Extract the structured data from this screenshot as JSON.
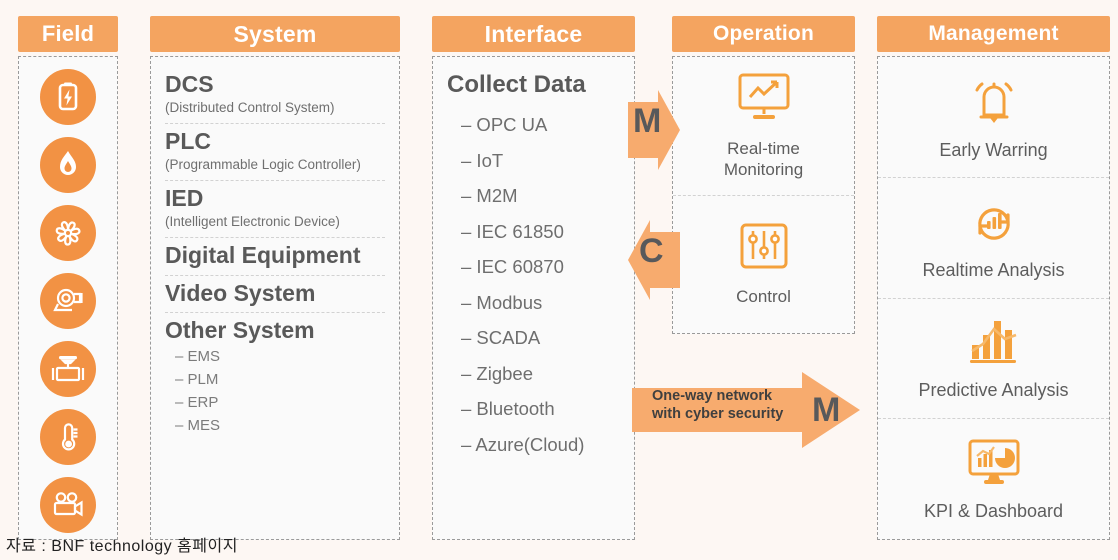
{
  "theme": {
    "header_orange": "#f4a460",
    "icon_orange": "#f29244",
    "arrow_orange": "#f6ab6c",
    "text_gray": "#595959",
    "page_bg": "#fdf7f3"
  },
  "columns": {
    "field": {
      "header": "Field",
      "items": [
        {
          "icon": "battery-power-icon",
          "label": "Power / Battery"
        },
        {
          "icon": "flame-icon",
          "label": "Boiler / Flame"
        },
        {
          "icon": "fan-turbine-icon",
          "label": "Fan / Turbine"
        },
        {
          "icon": "pump-motor-icon",
          "label": "Pump / Motor"
        },
        {
          "icon": "valve-icon",
          "label": "Valve"
        },
        {
          "icon": "thermometer-icon",
          "label": "Temperature Sensor"
        },
        {
          "icon": "video-camera-icon",
          "label": "Video Camera"
        }
      ]
    },
    "system": {
      "header": "System",
      "groups": [
        {
          "title": "DCS",
          "sub": "(Distributed Control System)",
          "items": []
        },
        {
          "title": "PLC",
          "sub": "(Programmable Logic Controller)",
          "items": []
        },
        {
          "title": "IED",
          "sub": "(Intelligent Electronic Device)",
          "items": []
        },
        {
          "title": "Digital Equipment",
          "sub": "",
          "items": []
        },
        {
          "title": "Video System",
          "sub": "",
          "items": []
        },
        {
          "title": "Other System",
          "sub": "",
          "items": [
            "– EMS",
            "– PLM",
            "– ERP",
            "– MES"
          ]
        }
      ]
    },
    "interface": {
      "header": "Interface",
      "title": "Collect Data",
      "items": [
        "– OPC UA",
        "– IoT",
        "– M2M",
        "– IEC 61850",
        "– IEC 60870",
        "– Modbus",
        "– SCADA",
        "– Zigbee",
        "– Bluetooth",
        "– Azure(Cloud)"
      ]
    },
    "operation": {
      "header": "Operation",
      "cells": [
        {
          "icon": "monitor-chart-icon",
          "label": "Real-time\nMonitoring"
        },
        {
          "icon": "sliders-control-icon",
          "label": "Control"
        }
      ]
    },
    "management": {
      "header": "Management",
      "cells": [
        {
          "icon": "bell-alarm-icon",
          "label": "Early Warring"
        },
        {
          "icon": "refresh-bars-icon",
          "label": "Realtime Analysis"
        },
        {
          "icon": "trend-bars-icon",
          "label": "Predictive Analysis"
        },
        {
          "icon": "monitor-dashboard-icon",
          "label": "KPI & Dashboard"
        }
      ]
    }
  },
  "arrows": {
    "monitor_in": {
      "letter": "M",
      "direction": "right"
    },
    "control_out": {
      "letter": "C",
      "direction": "left"
    },
    "oneway": {
      "letter": "M",
      "direction": "right",
      "line1": "One-way network",
      "line2": "with cyber security"
    }
  },
  "caption": "자료 : BNF technology 홈페이지"
}
